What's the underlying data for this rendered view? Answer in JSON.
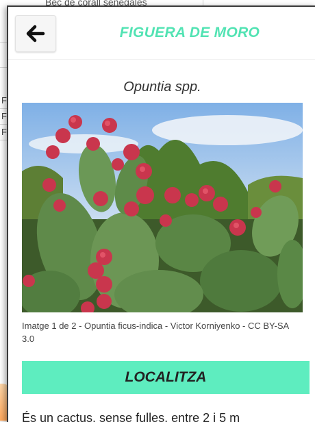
{
  "background": {
    "top_row_text": "Bec de corall senegalès",
    "row_labels": [
      "F",
      "F",
      "F"
    ]
  },
  "header": {
    "back_icon": "arrow-left-icon",
    "title": "FIGUERA DE MORO"
  },
  "species": {
    "scientific_name": "Opuntia spp."
  },
  "image": {
    "caption": "Imatge 1 de 2 - Opuntia ficus-indica - Victor Korniyenko - CC BY-SA 3.0"
  },
  "actions": {
    "locate_label": "LOCALITZA"
  },
  "description": {
    "text": "És un cactus, sense fulles, entre 2 i 5 m"
  },
  "colors": {
    "accent": "#52e3b3",
    "button": "#5eedbf"
  }
}
